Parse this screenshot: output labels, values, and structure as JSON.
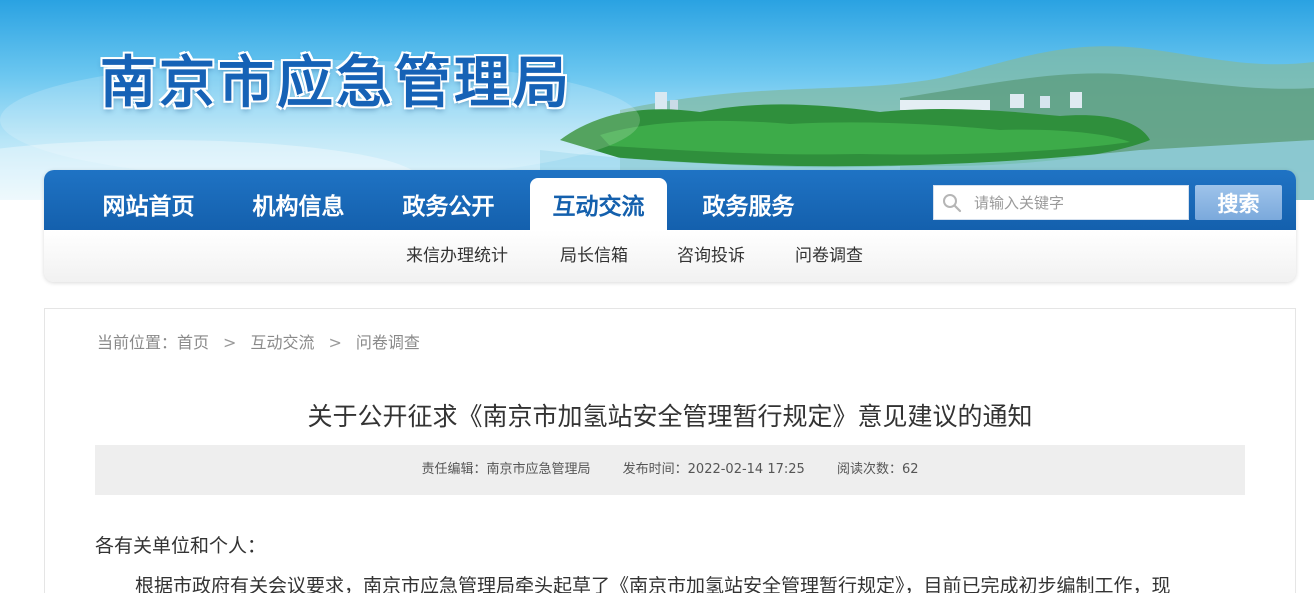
{
  "header": {
    "site_title": "南京市应急管理局"
  },
  "nav": {
    "items": [
      {
        "label": "网站首页"
      },
      {
        "label": "机构信息"
      },
      {
        "label": "政务公开"
      },
      {
        "label": "互动交流"
      },
      {
        "label": "政务服务"
      }
    ],
    "active_index": 3,
    "search": {
      "placeholder": "请输入关键字",
      "button_label": "搜索",
      "icon": "search-icon"
    }
  },
  "subnav": {
    "items": [
      {
        "label": "来信办理统计"
      },
      {
        "label": "局长信箱"
      },
      {
        "label": "咨询投诉"
      },
      {
        "label": "问卷调查"
      }
    ]
  },
  "breadcrumb": {
    "prefix": "当前位置：",
    "items": [
      "首页",
      "互动交流",
      "问卷调查"
    ],
    "separator": ">"
  },
  "article": {
    "title": "关于公开征求《南京市加氢站安全管理暂行规定》意见建议的通知",
    "meta": {
      "editor": "责任编辑：南京市应急管理局",
      "published": "发布时间：2022-02-14 17:25",
      "views": "阅读次数：62"
    },
    "greeting": "各有关单位和个人：",
    "paragraph": "根据市政府有关会议要求，南京市应急管理局牵头起草了《南京市加氢站安全管理暂行规定》，目前已完成初步编制工作，现"
  },
  "colors": {
    "primary": "#1460ad",
    "search_button": "#7ba9dc",
    "meta_bg": "#eeeeee"
  }
}
